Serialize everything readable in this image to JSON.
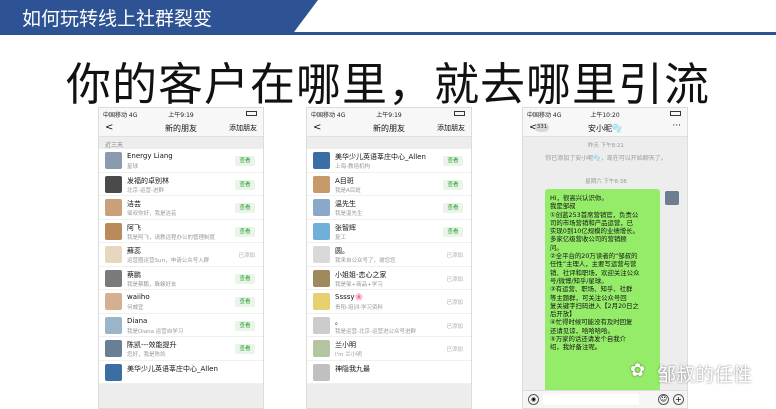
{
  "slide": {
    "title": "如何玩转线上社群裂变",
    "headline": "你的客户在哪里，就去哪里引流",
    "watermark": "邹叔的任性",
    "accent_color": "#2e5395"
  },
  "phone1": {
    "carrier": "中国移动 4G",
    "time": "上午9:19",
    "back": "<",
    "nav_title": "新的朋友",
    "nav_right": "添加朋友",
    "section": "近三天",
    "rows": [
      {
        "name": "Energy Liang",
        "sub": "星球",
        "action": "查看",
        "status": ""
      },
      {
        "name": "发福的卓别林",
        "sub": "北京-运营-进群",
        "action": "查看",
        "status": ""
      },
      {
        "name": "洁芸",
        "sub": "邹叔你好，我是洁芸",
        "action": "查看",
        "status": ""
      },
      {
        "name": "阿飞",
        "sub": "我是阿飞，请教远程办公的管理制度",
        "action": "查看",
        "status": ""
      },
      {
        "name": "蘇蕊",
        "sub": "运营圈运营Suri，申请公众号入群",
        "action": "",
        "status": "已添加"
      },
      {
        "name": "蔡鹏",
        "sub": "我是蔡鹏，躲躲好友",
        "action": "查看",
        "status": ""
      },
      {
        "name": "waiiho",
        "sub": "何威宜",
        "action": "查看",
        "status": ""
      },
      {
        "name": "Diana",
        "sub": "我是Diana 运营自学习",
        "action": "查看",
        "status": ""
      },
      {
        "name": "陈凯---效能提升",
        "sub": "您好，我是陈凯",
        "action": "查看",
        "status": ""
      },
      {
        "name": "美华少儿英语莘庄中心_Allen",
        "sub": "",
        "action": "",
        "status": ""
      }
    ]
  },
  "phone2": {
    "carrier": "中国移动 4G",
    "time": "上午9:19",
    "back": "<",
    "nav_title": "新的朋友",
    "nav_right": "添加朋友",
    "rows": [
      {
        "name": "美华少儿英语莘庄中心_Allen",
        "sub": "上海-教培机构",
        "action": "查看",
        "status": ""
      },
      {
        "name": "A目斑",
        "sub": "我是A目斑",
        "action": "查看",
        "status": ""
      },
      {
        "name": "温先生",
        "sub": "我是温先生",
        "action": "查看",
        "status": ""
      },
      {
        "name": "张智辉",
        "sub": "复工",
        "action": "查看",
        "status": ""
      },
      {
        "name": "圆。",
        "sub": "我来自公众号了，谢您您",
        "action": "",
        "status": "已添加"
      },
      {
        "name": "小姐姐-恋心之家",
        "sub": "我是邹+商品+学习",
        "action": "",
        "status": "已添加"
      },
      {
        "name": "Ssssy🌸",
        "sub": "贵阳-培训-学习资料",
        "action": "",
        "status": "已添加"
      },
      {
        "name": "。",
        "sub": "我是运营-北京-运营进公众号进群",
        "action": "",
        "status": "已添加"
      },
      {
        "name": "兰小明",
        "sub": "I'm 兰小明",
        "action": "",
        "status": "已添加"
      },
      {
        "name": "神隐我九最",
        "sub": "",
        "action": "",
        "status": ""
      }
    ]
  },
  "phone3": {
    "carrier": "中国移动 4G",
    "time": "上午10:20",
    "back": "<",
    "badge": "331",
    "nav_title": "安小昵🫧",
    "more": "···",
    "stamp1": "昨天 下午8:21",
    "system_msg": "你已添加了安小昵🫧，现在可以开始聊天了。",
    "stamp2": "星期六 下午8:38",
    "message_lines": [
      "Hi，很高兴认识你。",
      "我是邹叔",
      "①创蓝253首席营销官，负责公",
      "司的市场营销和产品运营，已",
      "实现0到10亿规模的业绩增长。",
      "多家亿级营收公司的营销顾",
      "问。",
      "②全平台的20万读者的“邹叔的",
      "任性”主理人，主要写运营与营",
      "销、社评和职场，欢迎关注公众",
      "号/微博/知乎/星球。",
      "③有运营、职场、知乎、社群",
      "等主题群，可关注公众号回",
      "复关键字扫码进入【2月20日之",
      "后开放】",
      "④忙得时候可能没有及时回复",
      "还请见谅，哈哈哈哈。",
      "⑤万家的话还请发个自我介",
      "绍，我好备注呢。"
    ]
  }
}
